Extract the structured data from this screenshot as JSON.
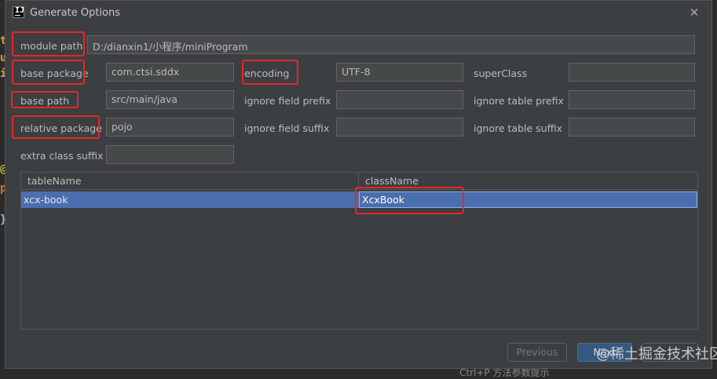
{
  "dialog": {
    "title": "Generate Options",
    "close_glyph": "✕"
  },
  "background": {
    "glyphs": [
      "t",
      "u",
      "i",
      "@",
      "p",
      "}"
    ],
    "bottom_hint": "Ctrl+P 方法参数提示"
  },
  "form": {
    "module_path": {
      "label": "module path",
      "value": "D:/dianxin1/小程序/miniProgram"
    },
    "base_package": {
      "label": "base package",
      "value": "com.ctsi.sddx"
    },
    "encoding": {
      "label": "encoding",
      "value": "UTF-8"
    },
    "super_class": {
      "label": "superClass",
      "value": ""
    },
    "base_path": {
      "label": "base path",
      "value": "src/main/java"
    },
    "ignore_field_prefix": {
      "label": "ignore field prefix",
      "value": ""
    },
    "ignore_table_prefix": {
      "label": "ignore table prefix",
      "value": ""
    },
    "relative_package": {
      "label": "relative package",
      "value": "pojo"
    },
    "ignore_field_suffix": {
      "label": "ignore field suffix",
      "value": ""
    },
    "ignore_table_suffix": {
      "label": "ignore table suffix",
      "value": ""
    },
    "extra_class_suffix": {
      "label": "extra class suffix",
      "value": ""
    }
  },
  "table": {
    "columns": [
      "tableName",
      "className"
    ],
    "rows": [
      {
        "tableName": "xcx-book",
        "className": "XcxBook"
      }
    ]
  },
  "buttons": {
    "previous": "Previous",
    "next": "Next"
  },
  "watermark": "@稀土掘金技术社区",
  "colors": {
    "highlight": "#e8252a",
    "selection": "#4b6eaf",
    "dialog_bg": "#3c3f41"
  }
}
